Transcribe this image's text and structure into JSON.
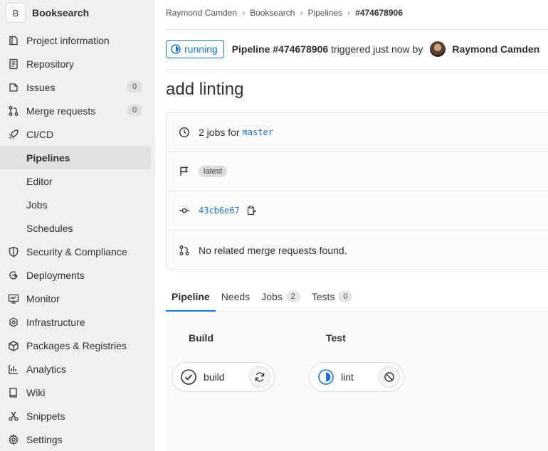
{
  "sidebar": {
    "project_initial": "B",
    "project_name": "Booksearch",
    "items": [
      {
        "label": "Project information",
        "icon": "info-document-icon"
      },
      {
        "label": "Repository",
        "icon": "doc-text-icon"
      },
      {
        "label": "Issues",
        "icon": "issues-icon",
        "count": "0"
      },
      {
        "label": "Merge requests",
        "icon": "merge-request-icon",
        "count": "0"
      },
      {
        "label": "CI/CD",
        "icon": "rocket-icon"
      },
      {
        "label": "Pipelines"
      },
      {
        "label": "Editor"
      },
      {
        "label": "Jobs"
      },
      {
        "label": "Schedules"
      },
      {
        "label": "Security & Compliance",
        "icon": "shield-icon"
      },
      {
        "label": "Deployments",
        "icon": "deployments-icon"
      },
      {
        "label": "Monitor",
        "icon": "monitor-icon"
      },
      {
        "label": "Infrastructure",
        "icon": "cloud-gear-icon"
      },
      {
        "label": "Packages & Registries",
        "icon": "package-icon"
      },
      {
        "label": "Analytics",
        "icon": "chart-icon"
      },
      {
        "label": "Wiki",
        "icon": "book-icon"
      },
      {
        "label": "Snippets",
        "icon": "scissors-icon"
      },
      {
        "label": "Settings",
        "icon": "gear-icon"
      }
    ]
  },
  "breadcrumb": [
    "Raymond Camden",
    "Booksearch",
    "Pipelines",
    "#474678906"
  ],
  "pipeline": {
    "status": "running",
    "title": "Pipeline #474678906",
    "triggered_text": "triggered just now by",
    "user": "Raymond Camden",
    "commit_title": "add linting",
    "jobs_text": "2 jobs for",
    "branch": "master",
    "tag": "latest",
    "sha": "43cb6e67",
    "mr_text": "No related merge requests found."
  },
  "tabs": [
    {
      "label": "Pipeline"
    },
    {
      "label": "Needs"
    },
    {
      "label": "Jobs",
      "count": "2"
    },
    {
      "label": "Tests",
      "count": "0"
    }
  ],
  "stages": [
    {
      "title": "Build",
      "job": "build",
      "job_status": "passed",
      "action": "retry-icon"
    },
    {
      "title": "Test",
      "job": "lint",
      "job_status": "running",
      "action": "cancel-icon"
    }
  ],
  "colors": {
    "accent": "#1f75cb",
    "sidebar_bg": "#f0f0f0"
  }
}
